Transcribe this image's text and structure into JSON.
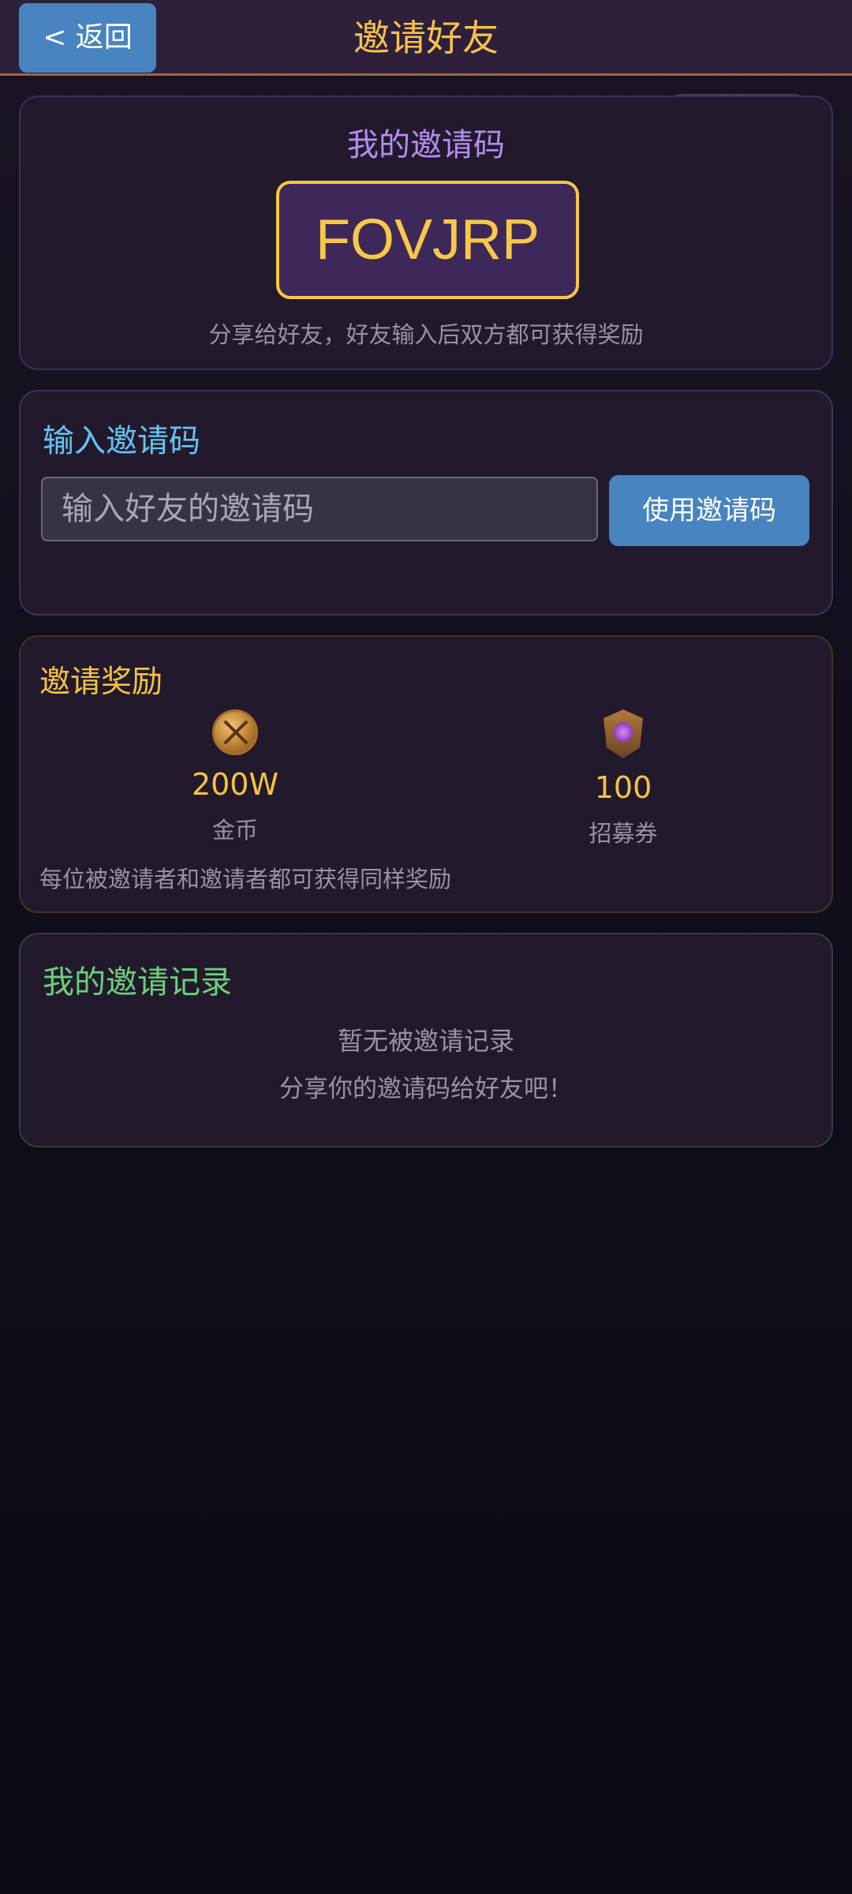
{
  "header": {
    "back_label": "< 返回",
    "title": "邀请好友"
  },
  "capsule": {
    "menu_icon": "more-dots-icon",
    "close_icon": "target-close-icon"
  },
  "my_code": {
    "title": "我的邀请码",
    "code": "FOVJRP",
    "hint": "分享给好友，好友输入后双方都可获得奖励"
  },
  "enter_code": {
    "title": "输入邀请码",
    "placeholder": "输入好友的邀请码",
    "value": "",
    "button_label": "使用邀请码"
  },
  "rewards": {
    "title": "邀请奖励",
    "items": [
      {
        "icon": "gold-coin-icon",
        "value": "200W",
        "name": "金币"
      },
      {
        "icon": "recruit-ticket-icon",
        "value": "100",
        "name": "招募券"
      }
    ],
    "note": "每位被邀请者和邀请者都可获得同样奖励"
  },
  "records": {
    "title": "我的邀请记录",
    "empty_text": "暂无被邀请记录",
    "hint": "分享你的邀请码给好友吧！"
  },
  "colors": {
    "accent_gold": "#f7c242",
    "button_blue": "#4784c0",
    "title_purple": "#b48cf0",
    "title_cyan": "#66c2f0",
    "title_green": "#6cd07a"
  }
}
